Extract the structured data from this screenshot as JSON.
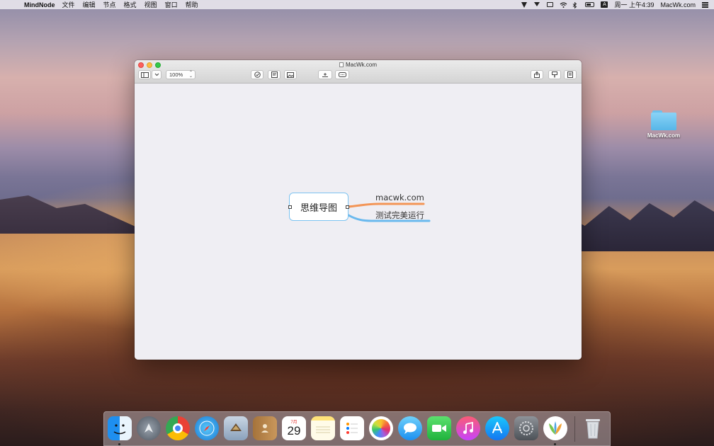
{
  "menubar": {
    "app_name": "MindNode",
    "menus": [
      "文件",
      "编辑",
      "节点",
      "格式",
      "视图",
      "窗口",
      "帮助"
    ],
    "clock": "周一 上午4:39",
    "user": "MacWk.com",
    "input_source": "A"
  },
  "desktop": {
    "folder_label": "MacWk.com"
  },
  "window": {
    "title": "MacWk.com",
    "zoom": "100%"
  },
  "mindmap": {
    "root": "思维导图",
    "branches": [
      {
        "label": "macwk.com",
        "color": "#f39556"
      },
      {
        "label": "测试完美运行",
        "color": "#6ab9ee"
      }
    ]
  },
  "calendar_icon": {
    "month": "7月",
    "day": "29"
  },
  "dock_apps": [
    "finder-icon",
    "launchpad-icon",
    "chrome-icon",
    "safari-icon",
    "mail-icon",
    "contacts-icon",
    "calendar-icon",
    "notes-icon",
    "reminders-icon",
    "photos-icon",
    "messages-icon",
    "facetime-icon",
    "itunes-icon",
    "app-store-icon",
    "system-preferences-icon",
    "mindnode-icon",
    "trash-icon"
  ]
}
